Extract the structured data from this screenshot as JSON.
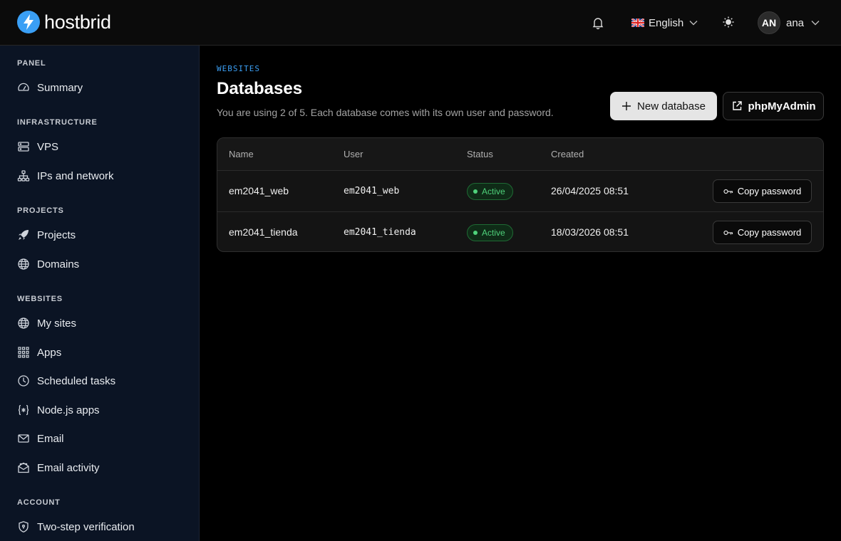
{
  "brand": {
    "name": "hostbrid"
  },
  "header": {
    "language": "English",
    "user_initials": "AN",
    "user_name": "ana"
  },
  "sidebar": {
    "sections": [
      {
        "title": "PANEL",
        "items": [
          {
            "label": "Summary",
            "icon": "gauge-icon"
          }
        ]
      },
      {
        "title": "INFRASTRUCTURE",
        "items": [
          {
            "label": "VPS",
            "icon": "server-icon"
          },
          {
            "label": "IPs and network",
            "icon": "network-icon"
          }
        ]
      },
      {
        "title": "PROJECTS",
        "items": [
          {
            "label": "Projects",
            "icon": "rocket-icon"
          },
          {
            "label": "Domains",
            "icon": "globe-icon"
          }
        ]
      },
      {
        "title": "WEBSITES",
        "items": [
          {
            "label": "My sites",
            "icon": "globe-icon"
          },
          {
            "label": "Apps",
            "icon": "grid-icon"
          },
          {
            "label": "Scheduled tasks",
            "icon": "clock-icon"
          },
          {
            "label": "Node.js apps",
            "icon": "braces-icon"
          },
          {
            "label": "Email",
            "icon": "mail-icon"
          },
          {
            "label": "Email activity",
            "icon": "mail-open-icon"
          }
        ]
      },
      {
        "title": "ACCOUNT",
        "items": [
          {
            "label": "Two-step verification",
            "icon": "shield-icon"
          }
        ]
      }
    ]
  },
  "main": {
    "eyebrow": "WEBSITES",
    "title": "Databases",
    "subtitle": "You are using 2 of 5. Each database comes with its own user and password.",
    "new_button": "New database",
    "phpmyadmin_button": "phpMyAdmin",
    "table": {
      "columns": [
        "Name",
        "User",
        "Status",
        "Created"
      ],
      "rows": [
        {
          "name": "em2041_web",
          "user": "em2041_web",
          "status": "Active",
          "created": "26/04/2025 08:51",
          "action": "Copy password"
        },
        {
          "name": "em2041_tienda",
          "user": "em2041_tienda",
          "status": "Active",
          "created": "18/03/2026 08:51",
          "action": "Copy password"
        }
      ]
    }
  },
  "colors": {
    "accent": "#3b9ff4",
    "sidebar_bg": "#0b1424",
    "status_active": "#4fd27b"
  }
}
